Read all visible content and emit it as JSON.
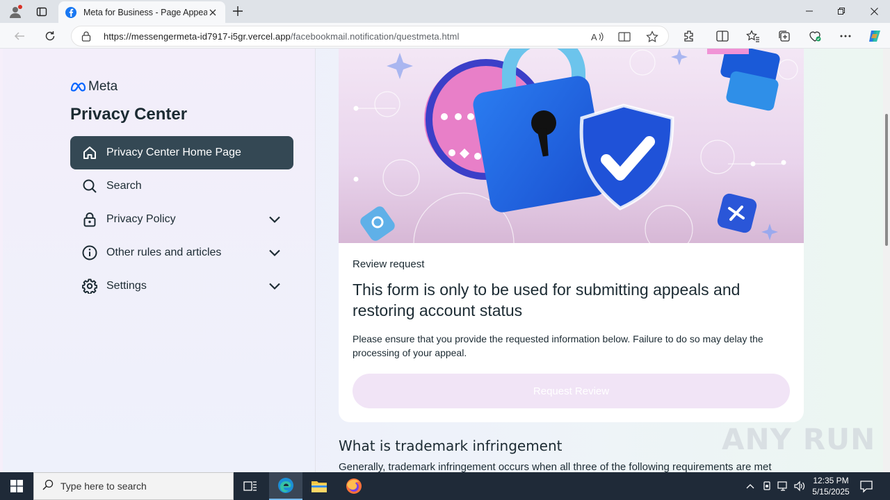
{
  "browser": {
    "tab_title": "Meta for Business - Page Appeal",
    "url_host": "https://messengermeta-id7917-i5gr.vercel.app",
    "url_path": "/facebookmail.notification/questmeta.html"
  },
  "sidebar": {
    "logo_text": "Meta",
    "title": "Privacy Center",
    "items": [
      {
        "label": "Privacy Center Home Page",
        "icon": "home-icon",
        "active": true
      },
      {
        "label": "Search",
        "icon": "search-icon"
      },
      {
        "label": "Privacy Policy",
        "icon": "lock-icon",
        "expandable": true
      },
      {
        "label": "Other rules and articles",
        "icon": "info-icon",
        "expandable": true
      },
      {
        "label": "Settings",
        "icon": "gear-icon",
        "expandable": true
      }
    ]
  },
  "main": {
    "kicker": "Review request",
    "headline": "This form is only to be used for submitting appeals and restoring account status",
    "body": "Please ensure that you provide the requested information below. Failure to do so may delay the processing of your appeal.",
    "button_label": "Request Review",
    "section_title": "What is trademark infringement",
    "section_body": "Generally, trademark infringement occurs when all three of the following requirements are met"
  },
  "watermark": "ANY RUN",
  "taskbar": {
    "search_placeholder": "Type here to search",
    "time": "12:35 PM",
    "date": "5/15/2025"
  },
  "colors": {
    "active_nav": "#344854",
    "text_dark": "#1c2b33",
    "meta_blue": "#0866ff",
    "button_disabled": "#f1e4f6"
  }
}
